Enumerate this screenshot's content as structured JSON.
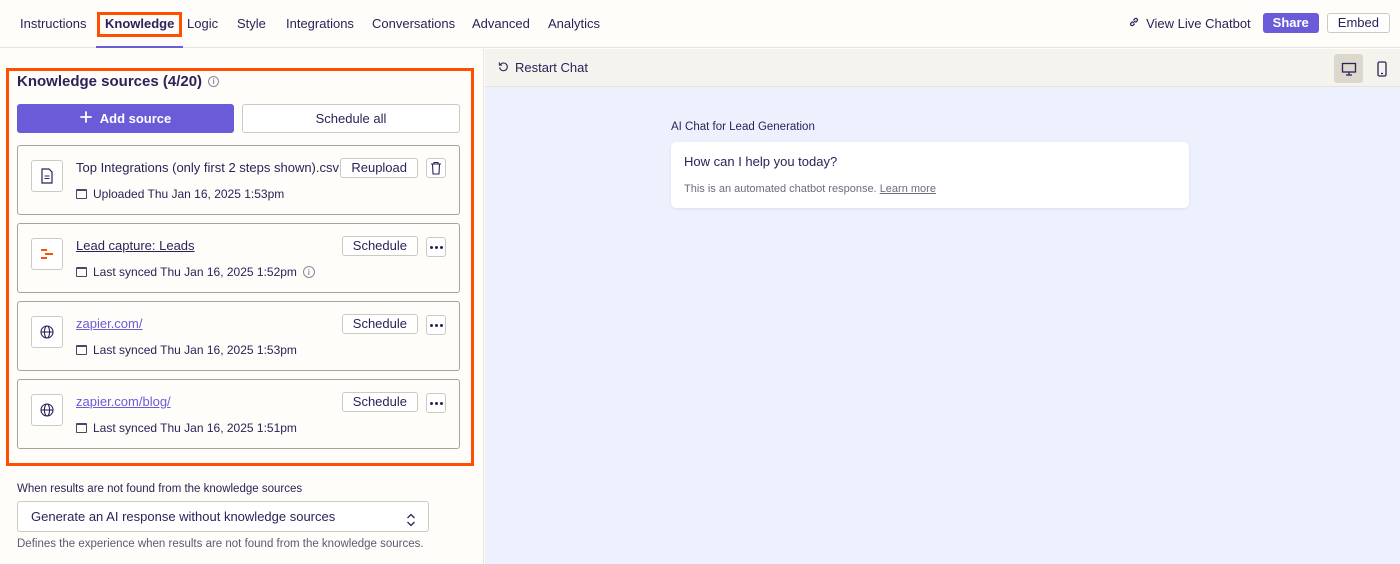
{
  "nav": {
    "tabs": [
      {
        "label": "Instructions"
      },
      {
        "label": "Knowledge"
      },
      {
        "label": "Logic"
      },
      {
        "label": "Style"
      },
      {
        "label": "Integrations"
      },
      {
        "label": "Conversations"
      },
      {
        "label": "Advanced"
      },
      {
        "label": "Analytics"
      }
    ],
    "active_tab": "Knowledge",
    "view_live": "View Live Chatbot",
    "share": "Share",
    "embed": "Embed"
  },
  "knowledge": {
    "title": "Knowledge sources (4/20)",
    "add_source": "Add source",
    "schedule_all": "Schedule all",
    "sources": [
      {
        "name": "Top Integrations (only first 2 steps shown).csv",
        "meta": "Uploaded Thu Jan 16, 2025 1:53pm",
        "action": "Reupload",
        "icon": "file-icon"
      },
      {
        "name": "Lead capture: Leads",
        "meta": "Last synced Thu Jan 16, 2025 1:52pm",
        "action": "Schedule",
        "icon": "tables-icon"
      },
      {
        "name": "zapier.com/",
        "meta": "Last synced Thu Jan 16, 2025 1:53pm",
        "action": "Schedule",
        "icon": "globe-icon"
      },
      {
        "name": "zapier.com/blog/",
        "meta": "Last synced Thu Jan 16, 2025 1:51pm",
        "action": "Schedule",
        "icon": "globe-icon"
      }
    ],
    "fallback_label": "When results are not found from the knowledge sources",
    "fallback_value": "Generate an AI response without knowledge sources",
    "fallback_helper": "Defines the experience when results are not found from the knowledge sources."
  },
  "preview": {
    "restart": "Restart Chat",
    "chat_title": "AI Chat for Lead Generation",
    "message": "How can I help you today?",
    "note": "This is an automated chatbot response.",
    "learn_more": "Learn more"
  },
  "colors": {
    "accent": "#6a5bd8",
    "highlight": "#ff4f00",
    "text": "#2b2358",
    "preview_bg": "#edf1fd"
  }
}
